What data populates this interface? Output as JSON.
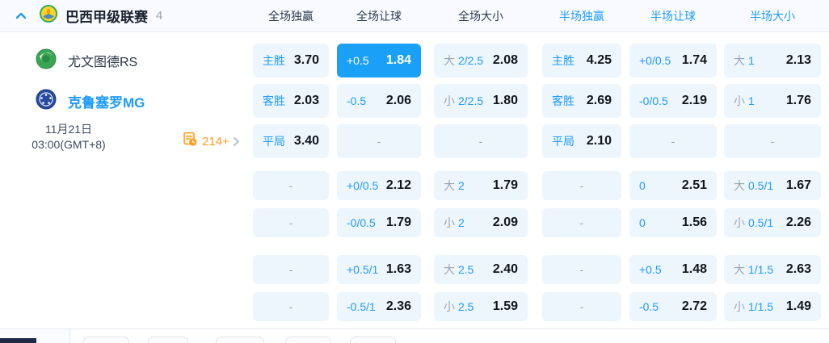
{
  "header": {
    "league": "巴西甲级联赛",
    "count": "4",
    "columns": [
      {
        "label": "全场独赢",
        "half": false
      },
      {
        "label": "全场让球",
        "half": false
      },
      {
        "label": "全场大小",
        "half": false
      },
      {
        "label": "半场独赢",
        "half": true
      },
      {
        "label": "半场让球",
        "half": true
      },
      {
        "label": "半场大小",
        "half": true
      }
    ]
  },
  "match": {
    "home_team": "尤文图德RS",
    "away_team": "克鲁塞罗MG",
    "date": "11月21日",
    "time": "03:00(GMT+8)",
    "more_markets_count": "214+"
  },
  "odds_rows": [
    {
      "cells": [
        {
          "label": "主胜",
          "value": "3.70"
        },
        {
          "label": "+0.5",
          "value": "1.84",
          "highlight": true
        },
        {
          "prefix": "大",
          "label": "2/2.5",
          "value": "2.08"
        },
        {
          "label": "主胜",
          "value": "4.25"
        },
        {
          "label": "+0/0.5",
          "value": "1.74"
        },
        {
          "prefix": "大",
          "label": "1",
          "value": "2.13"
        }
      ]
    },
    {
      "cells": [
        {
          "label": "客胜",
          "value": "2.03"
        },
        {
          "label": "-0.5",
          "value": "2.06"
        },
        {
          "prefix": "小",
          "label": "2/2.5",
          "value": "1.80"
        },
        {
          "label": "客胜",
          "value": "2.69"
        },
        {
          "label": "-0/0.5",
          "value": "2.19"
        },
        {
          "prefix": "小",
          "label": "1",
          "value": "1.76"
        }
      ]
    },
    {
      "cells": [
        {
          "label": "平局",
          "value": "3.40"
        },
        {
          "dash": true
        },
        {
          "dash": true
        },
        {
          "label": "平局",
          "value": "2.10"
        },
        {
          "dash": true
        },
        {
          "dash": true
        }
      ]
    },
    {
      "cells": [
        {
          "dash": true
        },
        {
          "label": "+0/0.5",
          "value": "2.12"
        },
        {
          "prefix": "大",
          "label": "2",
          "value": "1.79"
        },
        {
          "dash": true
        },
        {
          "label": "0",
          "value": "2.51"
        },
        {
          "prefix": "大",
          "label": "0.5/1",
          "value": "1.67"
        }
      ]
    },
    {
      "cells": [
        {
          "dash": true
        },
        {
          "label": "-0/0.5",
          "value": "1.79"
        },
        {
          "prefix": "小",
          "label": "2",
          "value": "2.09"
        },
        {
          "dash": true
        },
        {
          "label": "0",
          "value": "1.56"
        },
        {
          "prefix": "小",
          "label": "0.5/1",
          "value": "2.26"
        }
      ]
    },
    {
      "cells": [
        {
          "dash": true
        },
        {
          "label": "+0.5/1",
          "value": "1.63"
        },
        {
          "prefix": "大",
          "label": "2.5",
          "value": "2.40"
        },
        {
          "dash": true
        },
        {
          "label": "+0.5",
          "value": "1.48"
        },
        {
          "prefix": "大",
          "label": "1/1.5",
          "value": "2.63"
        }
      ]
    },
    {
      "cells": [
        {
          "dash": true
        },
        {
          "label": "-0.5/1",
          "value": "2.36"
        },
        {
          "prefix": "小",
          "label": "2.5",
          "value": "1.59"
        },
        {
          "dash": true
        },
        {
          "label": "-0.5",
          "value": "2.72"
        },
        {
          "prefix": "小",
          "label": "1/1.5",
          "value": "1.49"
        }
      ]
    }
  ],
  "colors": {
    "accent_blue": "#1e9bff",
    "highlight_cell_bg": "#1ba0f8",
    "cell_bg": "#edf5fd",
    "odds_text": "#10161f",
    "muted_gray": "#9aa7b8",
    "orange": "#ff9d1e",
    "home_logo_green": "#3aa655",
    "away_logo_blue": "#274b9f",
    "league_logo_yellow": "#ffd32a"
  }
}
